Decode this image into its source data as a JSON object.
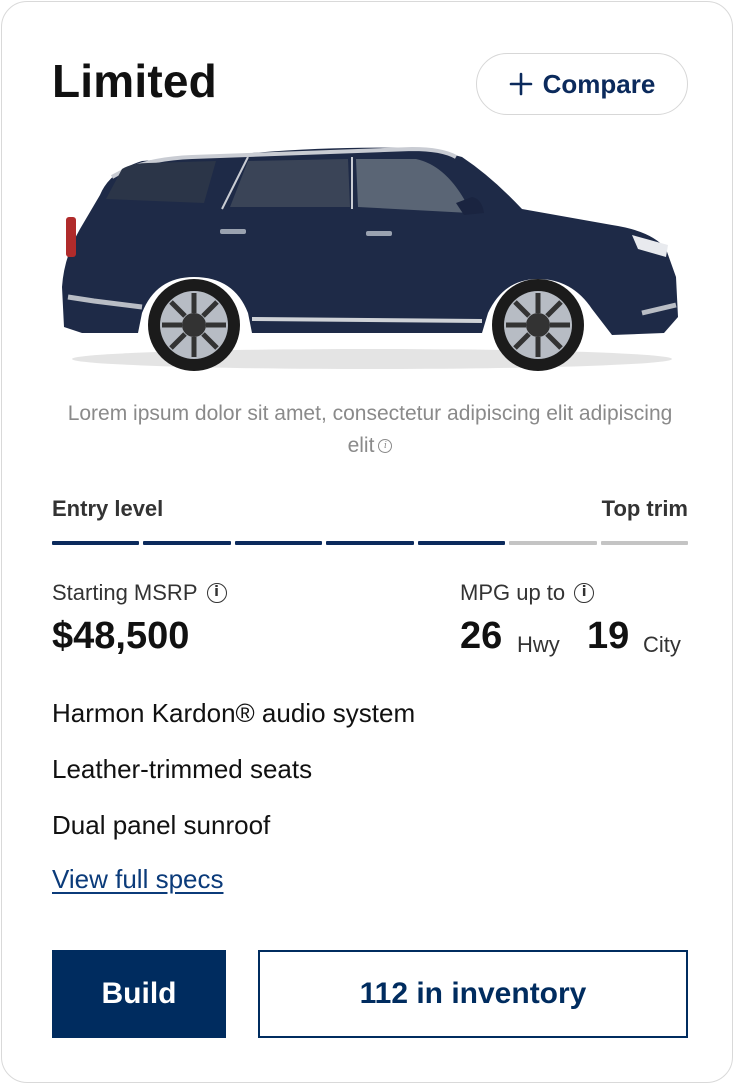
{
  "card": {
    "title": "Limited",
    "compare_label": "Compare",
    "disclaimer": "Lorem ipsum dolor sit amet, consectetur adipiscing elit adipiscing elit",
    "disclaimer_icon": "info-icon",
    "car_image": {
      "kind": "suv-side-view",
      "body_color": "#1e2a47"
    },
    "trim_level": {
      "left_label": "Entry level",
      "right_label": "Top trim",
      "total_segments": 7,
      "filled_segments": 5,
      "filled_color": "#0b2a5c",
      "empty_color": "#c4c4c4"
    },
    "msrp": {
      "label": "Starting MSRP",
      "value": "$48,500"
    },
    "mpg": {
      "label": "MPG up to",
      "hwy_value": "26",
      "hwy_unit": "Hwy",
      "city_value": "19",
      "city_unit": "City"
    },
    "features": [
      "Harmon Kardon® audio system",
      "Leather-trimmed seats",
      "Dual panel sunroof"
    ],
    "specs_link": "View full specs",
    "build_label": "Build",
    "inventory_label": "112 in inventory",
    "colors": {
      "brand": "#002c5f",
      "link": "#0b3b7a"
    }
  }
}
